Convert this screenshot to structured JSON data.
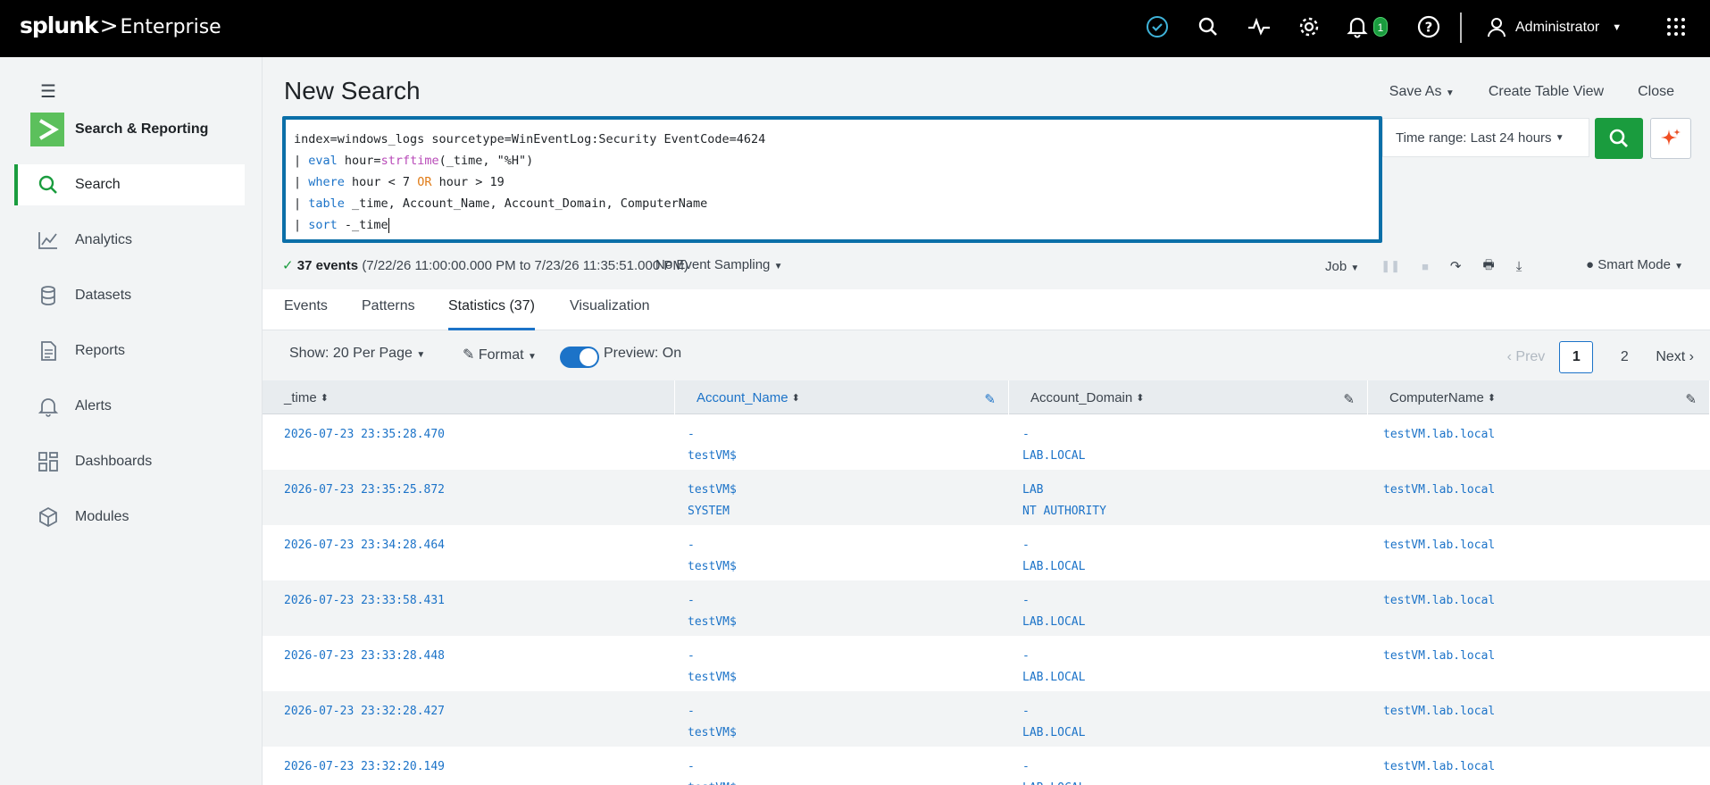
{
  "topbar": {
    "brand": "splunk",
    "product": "Enterprise",
    "notification_count": "1",
    "user": "Administrator",
    "icons": [
      "health-check-icon",
      "search-icon",
      "activity-icon",
      "gear-icon",
      "bell-icon",
      "help-icon",
      "apps-grid-icon"
    ]
  },
  "sidebar": {
    "app_name": "Search & Reporting",
    "items": [
      {
        "label": "Search",
        "icon": "search-icon"
      },
      {
        "label": "Analytics",
        "icon": "chart-icon"
      },
      {
        "label": "Datasets",
        "icon": "database-icon"
      },
      {
        "label": "Reports",
        "icon": "document-icon"
      },
      {
        "label": "Alerts",
        "icon": "bell-icon"
      },
      {
        "label": "Dashboards",
        "icon": "dashboard-icon"
      },
      {
        "label": "Modules",
        "icon": "cube-icon"
      }
    ]
  },
  "header": {
    "title": "New Search",
    "save_as": "Save As",
    "create_table_view": "Create Table View",
    "close": "Close"
  },
  "query": {
    "l1": "index=windows_logs sourcetype=WinEventLog:Security EventCode=4624",
    "l2_pipe": "| ",
    "l2_kw": "eval",
    "l2_a": " hour=",
    "l2_fn": "strftime",
    "l2_b": "(_time, \"%H\")",
    "l3_pipe": "| ",
    "l3_kw": "where",
    "l3_a": " hour < 7 ",
    "l3_op": "OR",
    "l3_b": " hour > 19",
    "l4_pipe": "| ",
    "l4_kw": "table",
    "l4_a": " _time, Account_Name, Account_Domain, ComputerName",
    "l5_pipe": "| ",
    "l5_kw": "sort",
    "l5_a": " -_time"
  },
  "time_range": "Time range: Last 24 hours",
  "status": {
    "count": "37 events",
    "range": "(7/22/26 11:00:00.000 PM to 7/23/26 11:35:51.000 PM)",
    "sampling": "No Event Sampling",
    "job": "Job",
    "mode": "Smart Mode"
  },
  "tabs": [
    "Events",
    "Patterns",
    "Statistics (37)",
    "Visualization"
  ],
  "toolbar": {
    "per_page": "Show: 20 Per Page",
    "format": "Format",
    "preview": "Preview: On",
    "prev": "Prev",
    "page1": "1",
    "page2": "2",
    "next": "Next"
  },
  "table": {
    "columns": [
      "_time",
      "Account_Name",
      "Account_Domain",
      "ComputerName"
    ],
    "rows": [
      {
        "time": "2026-07-23 23:35:28.470",
        "name": "-\ntestVM$",
        "domain": "-\nLAB.LOCAL",
        "computer": "testVM.lab.local"
      },
      {
        "time": "2026-07-23 23:35:25.872",
        "name": "testVM$\nSYSTEM",
        "domain": "LAB\nNT AUTHORITY",
        "computer": "testVM.lab.local"
      },
      {
        "time": "2026-07-23 23:34:28.464",
        "name": "-\ntestVM$",
        "domain": "-\nLAB.LOCAL",
        "computer": "testVM.lab.local"
      },
      {
        "time": "2026-07-23 23:33:58.431",
        "name": "-\ntestVM$",
        "domain": "-\nLAB.LOCAL",
        "computer": "testVM.lab.local"
      },
      {
        "time": "2026-07-23 23:33:28.448",
        "name": "-\ntestVM$",
        "domain": "-\nLAB.LOCAL",
        "computer": "testVM.lab.local"
      },
      {
        "time": "2026-07-23 23:32:28.427",
        "name": "-\ntestVM$",
        "domain": "-\nLAB.LOCAL",
        "computer": "testVM.lab.local"
      },
      {
        "time": "2026-07-23 23:32:20.149",
        "name": "-\ntestVM$",
        "domain": "-\nLAB.LOCAL",
        "computer": "testVM.lab.local"
      }
    ]
  },
  "colors": {
    "accent_green": "#1a9c3e",
    "link_blue": "#1c73c8",
    "query_border": "#0b6fa8"
  }
}
